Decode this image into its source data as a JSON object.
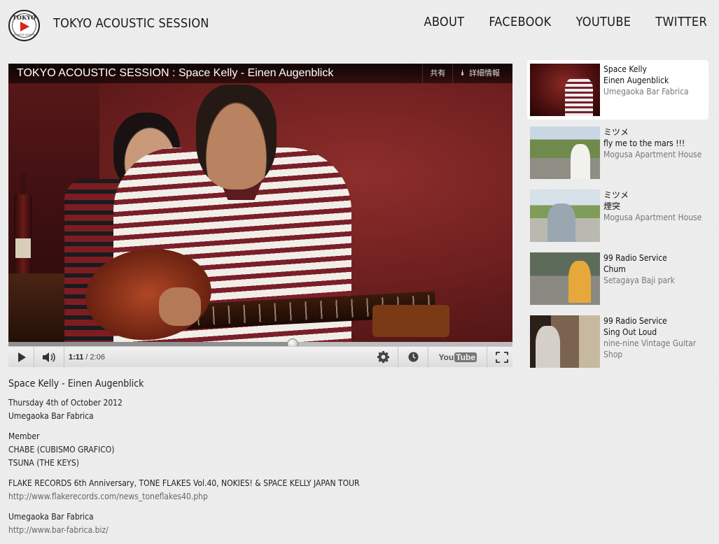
{
  "header": {
    "logo_word": "TOKYO",
    "logo_sub": "ACOUSTIC SESSION",
    "site_title": "TOKYO ACOUSTIC SESSION",
    "nav": [
      "ABOUT",
      "FACEBOOK",
      "YOUTUBE",
      "TWITTER"
    ]
  },
  "player": {
    "title": "TOKYO ACOUSTIC SESSION : Space Kelly - Einen Augenblick",
    "share_label": "共有",
    "info_label": "詳細情報",
    "time_current": "1:11",
    "time_total": "/ 2:06",
    "progress_fraction": 0.5635,
    "youtube_label": "You",
    "youtube_tube": "Tube"
  },
  "description": {
    "title": "Space Kelly - Einen Augenblick",
    "date": "Thursday 4th of October 2012",
    "venue": "Umegaoka Bar Fabrica",
    "member_heading": "Member",
    "members": [
      "CHABE (CUBISMO GRAFICO)",
      "TSUNA (THE KEYS)"
    ],
    "tour": "FLAKE RECORDS 6th Anniversary, TONE FLAKES Vol.40, NOKIES! & SPACE KELLY JAPAN TOUR",
    "tour_link": "http://www.flakerecords.com/news_toneflakes40.php",
    "venue2": "Umegaoka Bar Fabrica",
    "venue_link": "http://www.bar-fabrica.biz/"
  },
  "playlist": [
    {
      "artist": "Space Kelly",
      "song": "Einen Augenblick",
      "location": "Umegaoka Bar Fabrica",
      "thumb": "red",
      "active": true
    },
    {
      "artist": "ミツメ",
      "song": "fly me to the mars !!!",
      "location": "Mogusa Apartment House",
      "thumb": "green",
      "active": false
    },
    {
      "artist": "ミツメ",
      "song": "煙突",
      "location": "Mogusa Apartment House",
      "thumb": "green2",
      "active": false
    },
    {
      "artist": "99 Radio Service",
      "song": "Chum",
      "location": "Setagaya Baji park",
      "thumb": "street",
      "active": false
    },
    {
      "artist": "99 Radio Service",
      "song": "Sing Out Loud",
      "location": "nine-nine Vintage Guitar Shop",
      "thumb": "shop",
      "active": false
    }
  ],
  "colors": {
    "background": "#eeeeee",
    "logo_play": "#d9251c",
    "link": "#666666"
  }
}
